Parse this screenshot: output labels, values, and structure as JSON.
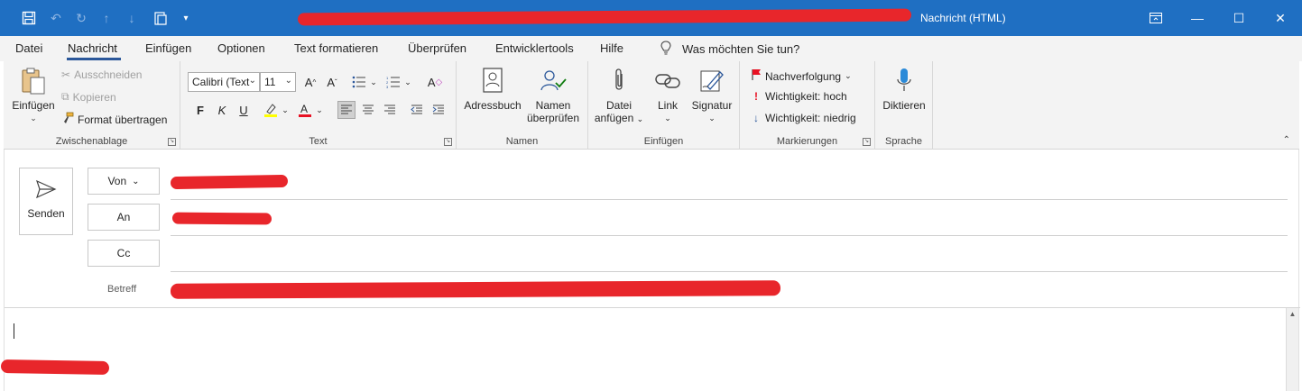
{
  "titlebar": {
    "window_title": "Nachricht (HTML)",
    "quick_access_icons": [
      "save-icon",
      "undo-icon",
      "redo-icon",
      "arrow-up-icon",
      "arrow-down-icon",
      "paste-icon",
      "customize-icon"
    ]
  },
  "tabs": [
    {
      "label": "Datei"
    },
    {
      "label": "Nachricht"
    },
    {
      "label": "Einfügen"
    },
    {
      "label": "Optionen"
    },
    {
      "label": "Text formatieren"
    },
    {
      "label": "Überprüfen"
    },
    {
      "label": "Entwicklertools"
    },
    {
      "label": "Hilfe"
    }
  ],
  "tell_me": {
    "placeholder": "Was möchten Sie tun?"
  },
  "ribbon": {
    "clipboard": {
      "label": "Zwischenablage",
      "paste": "Einfügen",
      "cut": "Ausschneiden",
      "copy": "Kopieren",
      "format_painter": "Format übertragen"
    },
    "text": {
      "label": "Text",
      "font": "Calibri (Text",
      "size": "11",
      "bold": "F",
      "italic": "K",
      "underline": "U"
    },
    "names": {
      "label": "Namen",
      "address_book": "Adressbuch",
      "check_names_line1": "Namen",
      "check_names_line2": "überprüfen"
    },
    "include": {
      "label": "Einfügen",
      "attach_line1": "Datei",
      "attach_line2": "anfügen",
      "link": "Link",
      "signature": "Signatur"
    },
    "tags": {
      "label": "Markierungen",
      "follow_up": "Nachverfolgung",
      "high": "Wichtigkeit: hoch",
      "low": "Wichtigkeit: niedrig"
    },
    "voice": {
      "label": "Sprache",
      "dictate": "Diktieren"
    }
  },
  "compose": {
    "send": "Senden",
    "from": "Von",
    "to": "An",
    "cc": "Cc",
    "subject_label": "Betreff"
  },
  "colors": {
    "titlebar": "#1f6fc2",
    "accent": "#2b579a",
    "redaction": "#e8262b"
  }
}
